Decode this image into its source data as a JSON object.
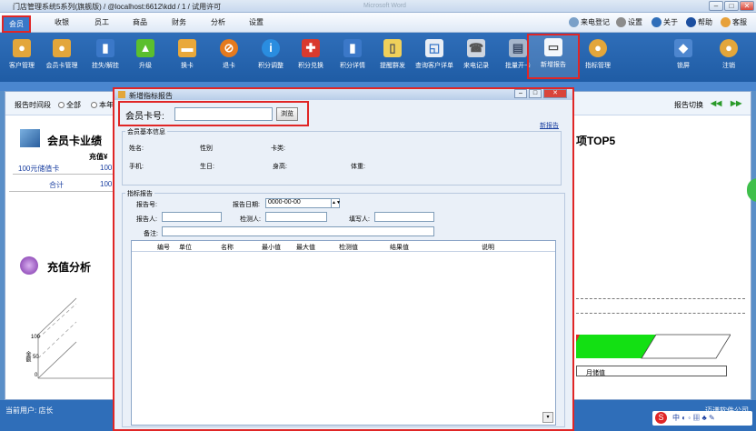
{
  "window": {
    "title": "门店管理系统5系列(旗舰版) / @localhost:6612\\kdd / 1 / 试用许可",
    "ghost_title": "Microsoft Word",
    "minimize": "–",
    "maximize": "□",
    "close": "✕"
  },
  "menu": {
    "items": [
      "会员",
      "收银",
      "员工",
      "商品",
      "财务",
      "分析",
      "设置"
    ],
    "right": [
      "来电登记",
      "设置",
      "关于",
      "帮助",
      "客服"
    ]
  },
  "toolbar": {
    "items": [
      "客户管理",
      "会员卡管理",
      "挂失/解挂",
      "升级",
      "换卡",
      "退卡",
      "积分调整",
      "积分兑换",
      "积分详情",
      "提醒群发",
      "查询客户详单",
      "来电记录",
      "批量开卡",
      "新增报告",
      "指标管理"
    ],
    "right_items": [
      "锁屏",
      "注销"
    ]
  },
  "filter": {
    "label": "报告时间段",
    "opt_all": "全部",
    "opt_year": "本年",
    "switch": "报告切换"
  },
  "left": {
    "perf_title": "会员卡业绩",
    "col_head": "充值¥",
    "row1_name": "100元储值卡",
    "row1_val": "100",
    "total_name": "合计",
    "total_val": "100",
    "charge_title": "充值分析",
    "ytick_top": "100",
    "ytick_mid": "50",
    "ytick_low": "0",
    "ylabel": "金额"
  },
  "right": {
    "top5_title": "项TOP5",
    "legend": "月储值"
  },
  "status": {
    "user": "当前用户: 店长",
    "brand": "迈谱软件公司"
  },
  "dialog": {
    "title": "新增指标报告",
    "card_label": "会员卡号:",
    "card_value": "",
    "browse_btn": "浏览",
    "new_report": "新报告",
    "member_section": "会员基本信息",
    "name_lbl": "姓名:",
    "gender_lbl": "性别",
    "cardtype_lbl": "卡类:",
    "phone_lbl": "手机:",
    "birthday_lbl": "生日:",
    "height_lbl": "身高:",
    "weight_lbl": "体重:",
    "report_section": "指标报告",
    "report_no_lbl": "报告号:",
    "report_date_lbl": "报告日期:",
    "report_date_val": "0000-00-00",
    "reporter_lbl": "报告人:",
    "inspector_lbl": "检测人:",
    "writer_lbl": "填写人:",
    "notes_lbl": "备注:",
    "columns": [
      "编号",
      "单位",
      "名称",
      "最小值",
      "最大值",
      "检测值",
      "结果值",
      "说明"
    ]
  },
  "colors": {
    "accent": "#2f6eb9",
    "highlight": "#e02626",
    "chart_green": "#13e013"
  }
}
